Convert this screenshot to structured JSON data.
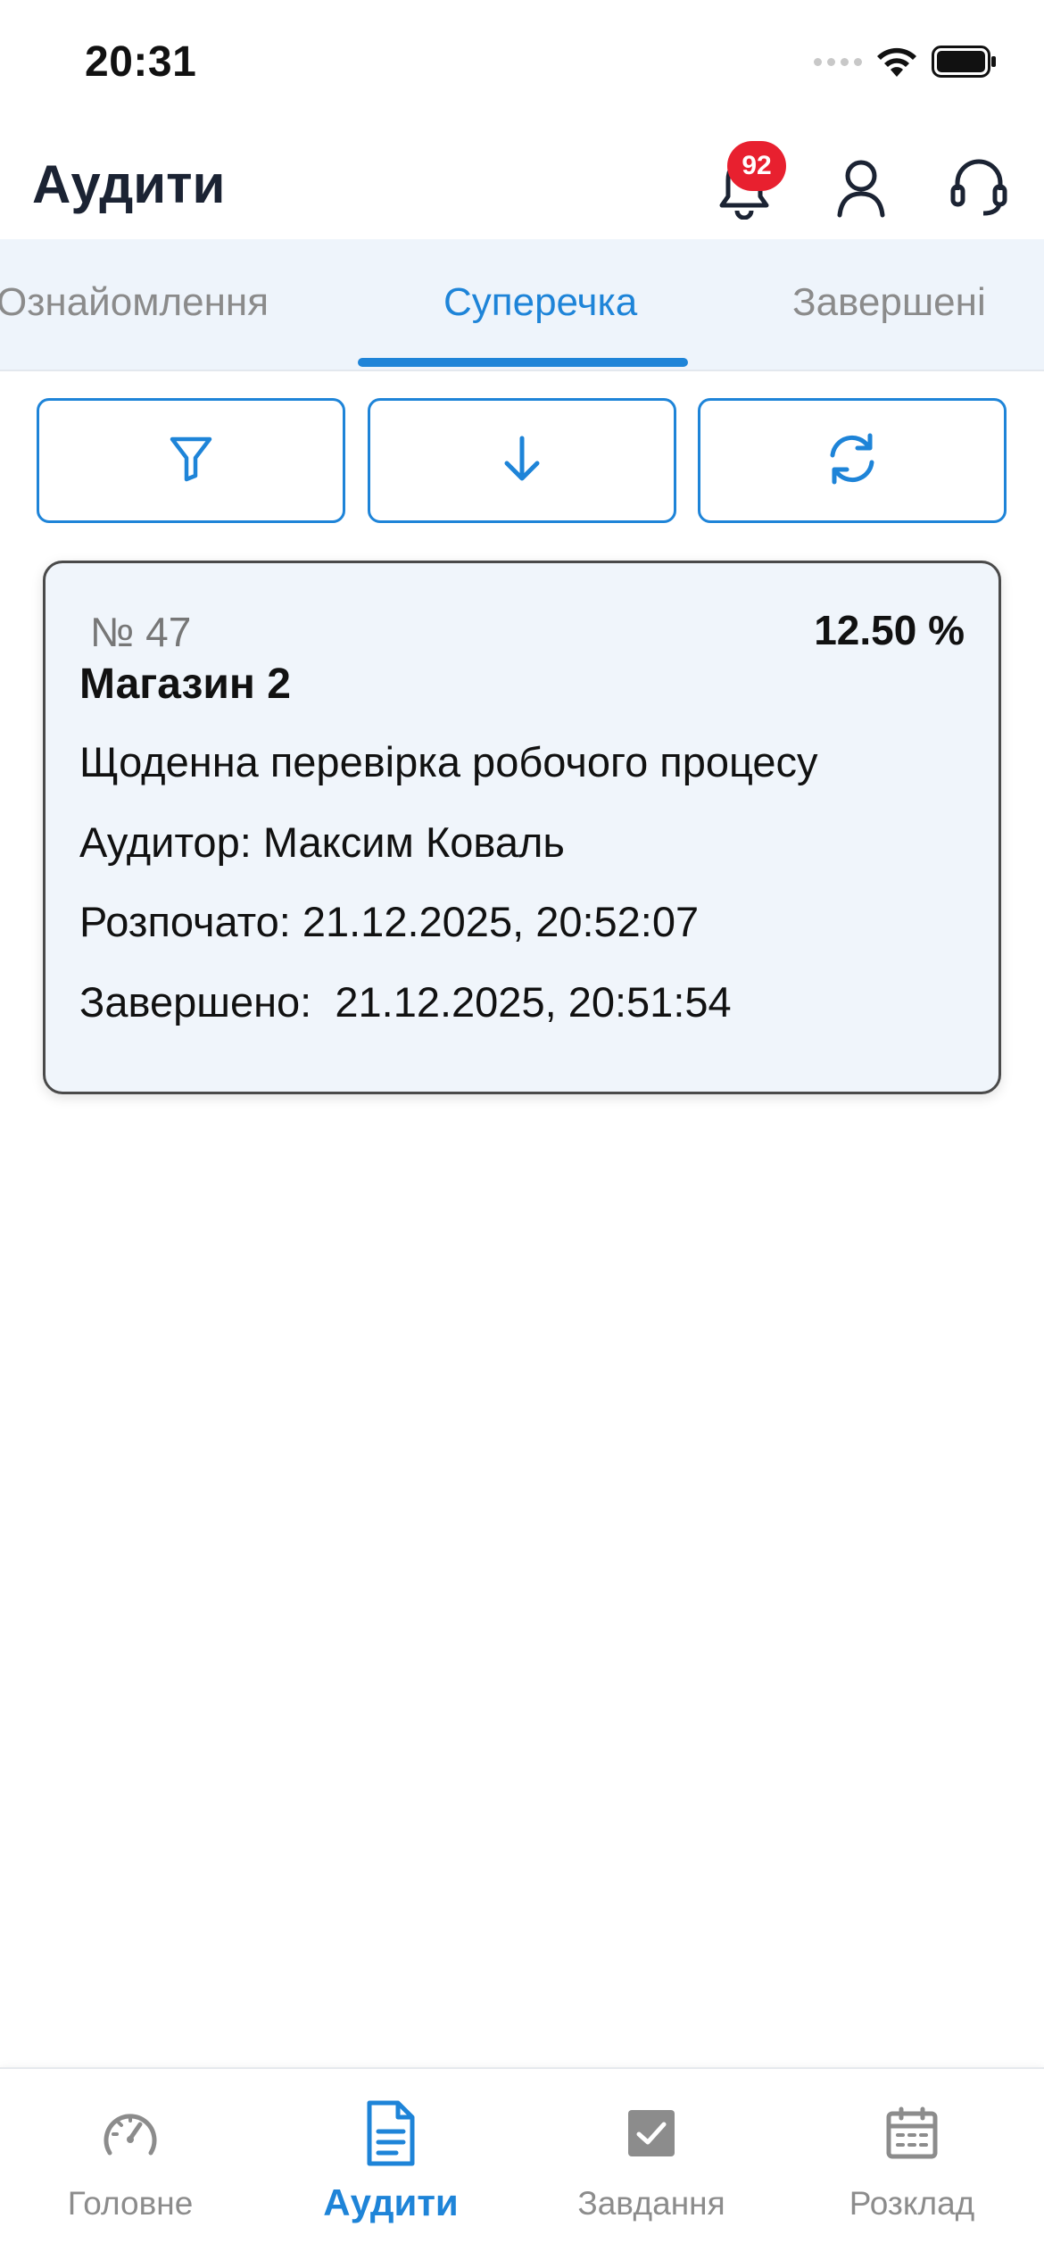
{
  "status_bar": {
    "time": "20:31"
  },
  "header": {
    "title": "Аудити",
    "notification_count": "92",
    "icons": [
      "bell-icon",
      "user-icon",
      "headset-icon"
    ]
  },
  "tabs": [
    {
      "label": "Ознайомлення",
      "active": false
    },
    {
      "label": "Суперечка",
      "active": true
    },
    {
      "label": "Завершені",
      "active": false
    }
  ],
  "actions": {
    "icons": [
      "filter-icon",
      "arrow-down-icon",
      "refresh-icon"
    ]
  },
  "audit_card": {
    "number": "№ 47",
    "percent": "12.50 %",
    "store": "Магазин 2",
    "description": "Щоденна перевірка робочого процесу",
    "auditor": "Аудитор: Максим Коваль",
    "started": "Розпочато: 21.12.2025, 20:52:07",
    "finished": "Завершено:  21.12.2025, 20:51:54"
  },
  "bottom_nav": [
    {
      "label": "Головне",
      "icon": "speedometer-icon",
      "active": false
    },
    {
      "label": "Аудити",
      "icon": "document-icon",
      "active": true
    },
    {
      "label": "Завдання",
      "icon": "checkbox-icon",
      "active": false
    },
    {
      "label": "Розклад",
      "icon": "calendar-icon",
      "active": false
    }
  ],
  "colors": {
    "accent": "#1e84d8",
    "badge": "#e8202f",
    "tab_bar_bg": "#eef4fb",
    "card_bg": "#f0f5fb",
    "inactive": "#8c8c8c"
  }
}
